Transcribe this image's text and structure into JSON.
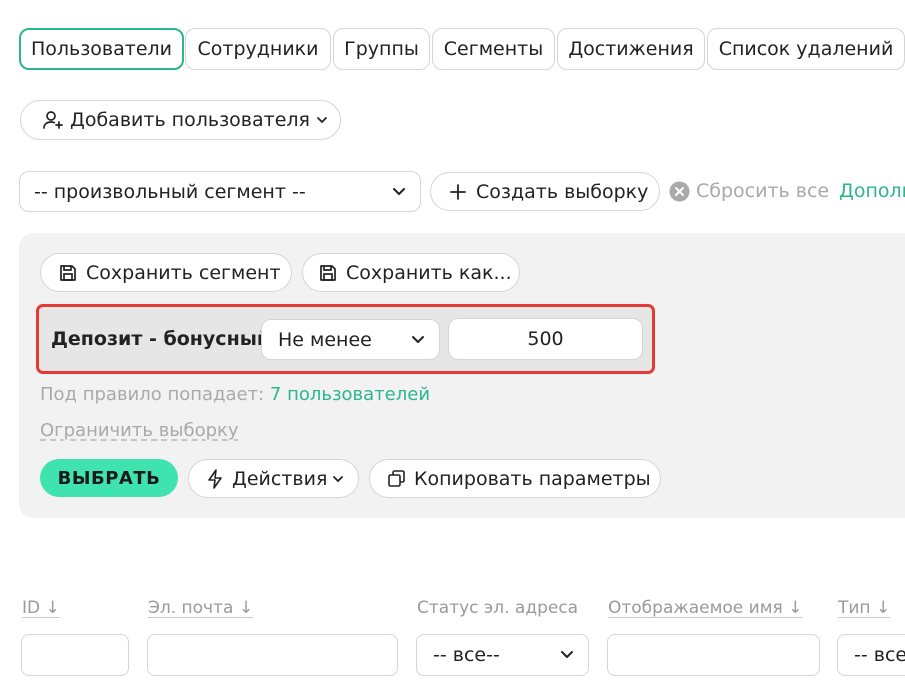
{
  "tabs": [
    {
      "label": "Пользователи",
      "active": true
    },
    {
      "label": "Сотрудники",
      "active": false
    },
    {
      "label": "Группы",
      "active": false
    },
    {
      "label": "Сегменты",
      "active": false
    },
    {
      "label": "Достижения",
      "active": false
    },
    {
      "label": "Список удалений",
      "active": false
    }
  ],
  "add_user_label": "Добавить пользователя",
  "segment_select_value": "-- произвольный сегмент --",
  "create_selection_label": "Создать выборку",
  "reset_all_label": "Сбросить все",
  "more_link_label": "Дополн",
  "save_segment_label": "Сохранить сегмент",
  "save_as_label": "Сохранить как...",
  "rule": {
    "field_label": "Депозит - бонусный",
    "operator_value": "Не менее",
    "value": "500"
  },
  "match_prefix": "Под правило попадает:",
  "match_link": "7 пользователей",
  "limit_link": "Ограничить выборку",
  "select_button_label": "ВЫБРАТЬ",
  "actions_label": "Действия",
  "copy_params_label": "Копировать параметры",
  "columns": {
    "id": "ID ↓",
    "email": "Эл. почта ↓",
    "email_status": "Статус эл. адреса",
    "display_name": "Отображаемое имя ↓",
    "type": "Тип ↓"
  },
  "filters": {
    "email_status_value": "-- все--",
    "type_value": "-- все"
  },
  "colors": {
    "accent": "#2bb68e",
    "highlight_border": "#e53935",
    "panel_bg": "#f2f2f2"
  }
}
